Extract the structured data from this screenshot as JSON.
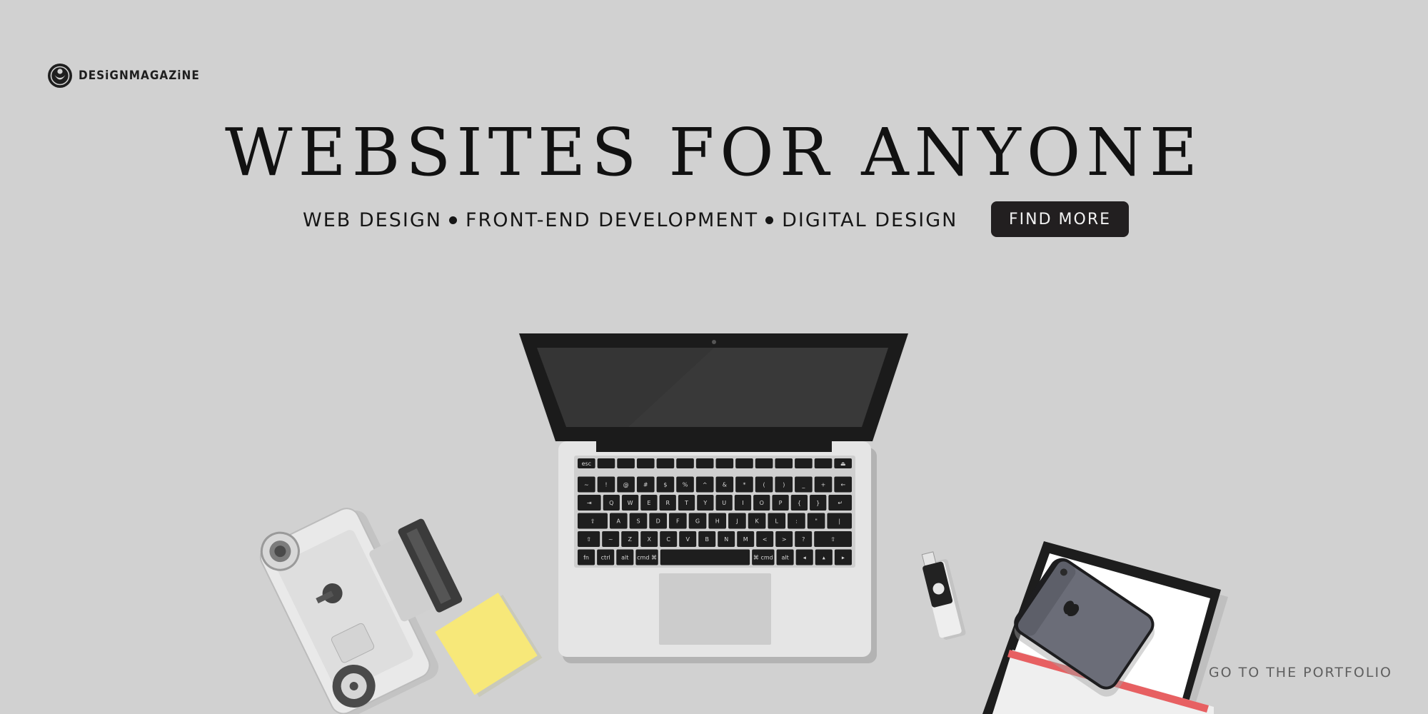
{
  "brand": {
    "name": "DESiGNMAGAZiNE",
    "logo_icon": "heart-face-icon"
  },
  "hero": {
    "headline": "WEBSITES FOR ANYONE",
    "services": [
      "WEB DESIGN",
      "FRONT-END DEVELOPMENT",
      "DIGITAL DESIGN"
    ],
    "cta_label": "FIND MORE"
  },
  "footer": {
    "portfolio_link": "GO TO THE PORTFOLIO"
  },
  "colors": {
    "background": "#d1d1d1",
    "text": "#111111",
    "button_bg": "#221f20",
    "button_text": "#f2f2f2",
    "sticky_note": "#f7e879",
    "accent_stripe": "#e76062"
  },
  "illustration": {
    "keyboard_keys": {
      "row1": [
        "esc",
        "",
        "",
        "",
        "",
        "",
        "",
        "",
        "",
        "",
        "",
        "",
        "",
        "⏏"
      ],
      "row2": [
        "~",
        "!",
        "@",
        "#",
        "$",
        "%",
        "^",
        "&",
        "*",
        "(",
        ")",
        "_",
        "+",
        "←"
      ],
      "row3": [
        "⇥",
        "Q",
        "W",
        "E",
        "R",
        "T",
        "Y",
        "U",
        "I",
        "O",
        "P",
        "{",
        "}",
        "↵"
      ],
      "row4": [
        "⇪",
        "A",
        "S",
        "D",
        "F",
        "G",
        "H",
        "J",
        "K",
        "L",
        ":",
        "\"",
        "|"
      ],
      "row5": [
        "⇧",
        "~",
        "Z",
        "X",
        "C",
        "V",
        "B",
        "N",
        "M",
        "<",
        ">",
        "?",
        "⇧"
      ],
      "row6": [
        "fn",
        "ctrl",
        "alt",
        "cmd ⌘",
        "",
        "⌘ cmd",
        "alt",
        "◂",
        "▴",
        "▸"
      ]
    }
  }
}
